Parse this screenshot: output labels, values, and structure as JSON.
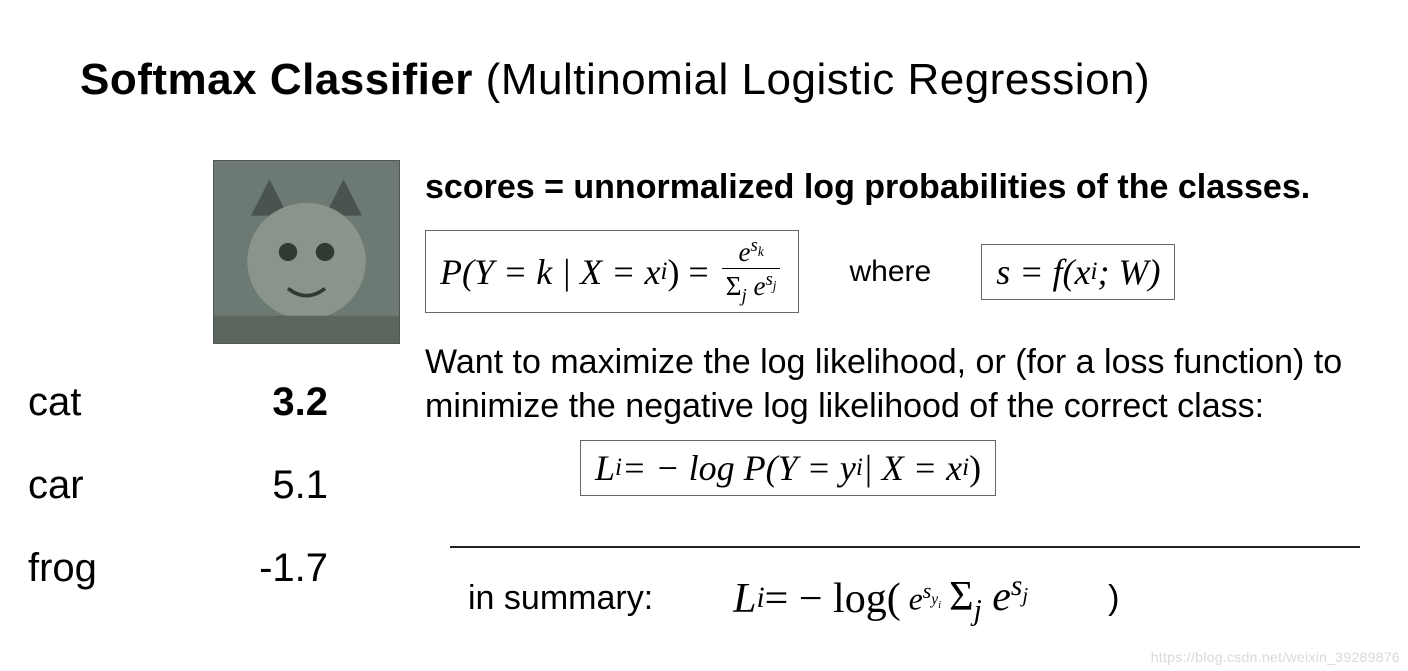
{
  "title": {
    "bold": "Softmax Classifier",
    "light": " (Multinomial Logistic Regression)"
  },
  "scores_heading": "scores = unnormalized log probabilities of the classes.",
  "where": "where",
  "want_text": "Want to maximize the log likelihood, or (for a loss function) to minimize the negative log likelihood of the correct class:",
  "summary_label": "in summary:",
  "scores": [
    {
      "label": "cat",
      "value": "3.2"
    },
    {
      "label": "car",
      "value": "5.1"
    },
    {
      "label": "frog",
      "value": "-1.7"
    }
  ],
  "eq": {
    "prob_lhs": "P(Y = k | X = x",
    "frac_num_e": "e",
    "frac_num_exp": "s",
    "frac_num_exp_sub": "k",
    "frac_den_sigma": "Σ",
    "frac_den_sigma_sub": "j",
    "frac_den_e": " e",
    "frac_den_exp": "s",
    "frac_den_exp_sub": "j",
    "s_eq": "s = f(x",
    "s_eq_tail": "; W)",
    "loss_lhs": "L",
    "loss_eq": " = − log P(Y = y",
    "loss_mid": " | X = x",
    "summary_lhs": "L",
    "summary_eq": " = − log(",
    "sum_frac_num_e": "e",
    "sum_frac_num_exp": "s",
    "sum_frac_num_exp_sub_y": "y",
    "sum_frac_num_exp_sub_i": "i",
    "sum_frac_den_sigma": "Σ",
    "sum_frac_den_sigma_sub": "j",
    "sum_frac_den_e": " e",
    "sum_frac_den_exp": "s",
    "sum_frac_den_exp_sub": "j",
    "close_paren": ")"
  },
  "watermark": "https://blog.csdn.net/weixin_39289876"
}
